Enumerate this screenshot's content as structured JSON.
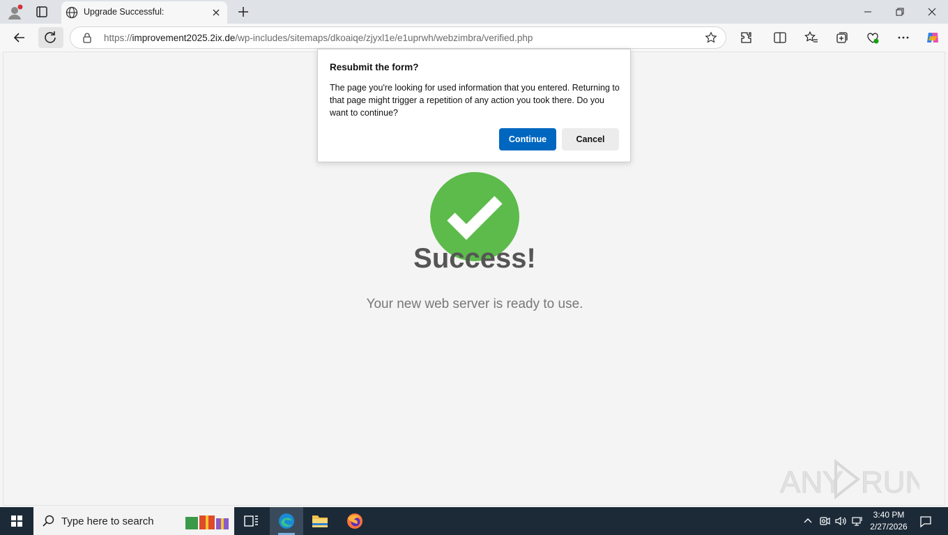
{
  "browser": {
    "tab": {
      "title": "Upgrade Successful:",
      "favicon": "globe-icon"
    },
    "address": {
      "prefix": "https://",
      "host": "improvement2025.2ix.de",
      "path": "/wp-includes/sitemaps/dkoaiqe/zjyxl1e/e1uprwh/webzimbra/verified.php"
    }
  },
  "dialog": {
    "title": "Resubmit the form?",
    "body": "The page you're looking for used information that you entered. Returning to that page might trigger a repetition of any action you took there. Do you want to continue?",
    "continue_label": "Continue",
    "cancel_label": "Cancel"
  },
  "page": {
    "heading": "Success!",
    "subtext": "Your new web server is ready to use.",
    "check_color": "#5cbb4b"
  },
  "watermark": {
    "text": "ANY RUN"
  },
  "taskbar": {
    "search_placeholder": "Type here to search",
    "time": "3:40 PM",
    "date": "2/27/2026"
  },
  "colors": {
    "accent": "#0067c0",
    "taskbar": "#1c2a38"
  }
}
